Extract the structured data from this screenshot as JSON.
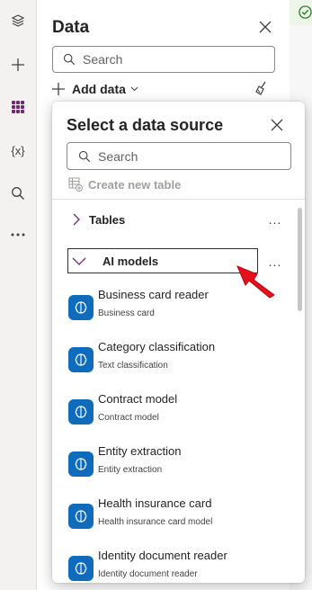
{
  "panel": {
    "title": "Data",
    "search_placeholder": "Search",
    "add_data_label": "Add data"
  },
  "rail": {
    "icons": [
      "layers-icon",
      "plus-icon",
      "data-grid-icon",
      "variables-icon",
      "search-icon",
      "more-icon"
    ],
    "variables_label": "{x}"
  },
  "popup": {
    "title": "Select a data source",
    "search_placeholder": "Search",
    "create_table_label": "Create new table",
    "sections": [
      {
        "label": "Tables",
        "expanded": false
      },
      {
        "label": "AI models",
        "expanded": true
      }
    ],
    "more_label": "...",
    "items": [
      {
        "name": "Business card reader",
        "sub": "Business card"
      },
      {
        "name": "Category classification",
        "sub": "Text classification"
      },
      {
        "name": "Contract model",
        "sub": "Contract model"
      },
      {
        "name": "Entity extraction",
        "sub": "Entity extraction"
      },
      {
        "name": "Health insurance card",
        "sub": "Health insurance card model"
      },
      {
        "name": "Identity document reader",
        "sub": "Identity document reader"
      }
    ]
  },
  "colors": {
    "accent": "#0f6cbd",
    "chevron": "#742774",
    "annotation_arrow": "#e8101c",
    "status_check": "#107c10"
  }
}
